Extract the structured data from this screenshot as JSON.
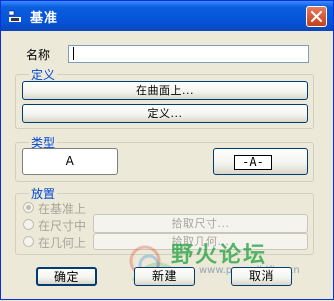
{
  "window": {
    "title": "基准",
    "title_icon": "datum-icon",
    "close_icon": "close-icon"
  },
  "name": {
    "label": "名称",
    "value": ""
  },
  "define": {
    "title": "定义",
    "on_surface_button": "在曲面上...",
    "define_button": "定义..."
  },
  "type": {
    "title": "类型",
    "option_a": "A",
    "option_a_boxed": "-A-"
  },
  "placement": {
    "title": "放置",
    "options": [
      {
        "label": "在基准上",
        "checked": true
      },
      {
        "label": "在尺寸中",
        "checked": false
      },
      {
        "label": "在几何上",
        "checked": false
      }
    ],
    "pick_dimension_button": "拾取尺寸...",
    "pick_geometry_button": "拾取几何..."
  },
  "footer": {
    "ok_button": "确定",
    "new_button": "新建",
    "cancel_button": "取消"
  },
  "watermark": {
    "text": "野火论坛",
    "url": "www.proewildfire.cn"
  },
  "colors": {
    "title_bar": "#0653d8",
    "group_title": "#0046d5",
    "dialog_bg": "#ece9d8"
  }
}
